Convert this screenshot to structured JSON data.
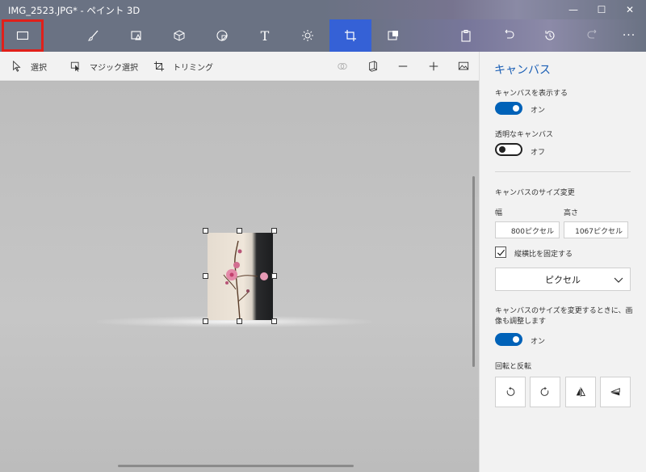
{
  "window": {
    "title": "IMG_2523.JPG* - ペイント 3D",
    "minimize": "—",
    "maximize": "☐",
    "close": "✕"
  },
  "toolbar": {
    "items": [
      {
        "id": "menu",
        "icon": "folder-icon"
      },
      {
        "id": "brushes",
        "icon": "brush-icon"
      },
      {
        "id": "2d-shapes",
        "icon": "shapes-2d-icon"
      },
      {
        "id": "3d-shapes",
        "icon": "cube-icon"
      },
      {
        "id": "stickers",
        "icon": "sticker-icon"
      },
      {
        "id": "text",
        "icon": "text-icon",
        "label": "T"
      },
      {
        "id": "effects",
        "icon": "sun-icon"
      },
      {
        "id": "canvas",
        "icon": "crop-icon",
        "active": true
      },
      {
        "id": "3d-library",
        "icon": "library-icon"
      },
      {
        "id": "paste",
        "icon": "paste-icon"
      },
      {
        "id": "undo",
        "icon": "undo-icon"
      },
      {
        "id": "history",
        "icon": "history-icon"
      },
      {
        "id": "redo",
        "icon": "redo-icon",
        "disabled": true
      },
      {
        "id": "more",
        "icon": "more-icon",
        "label": "···"
      }
    ],
    "accent_color": "#3561d6",
    "highlight_color": "#e0201a"
  },
  "subbar": {
    "select": "選択",
    "magic_select": "マジック選択",
    "crop": "トリミング"
  },
  "panel": {
    "title": "キャンバス",
    "show_canvas_label": "キャンバスを表示する",
    "show_canvas_state": "オン",
    "transparent_label": "透明なキャンバス",
    "transparent_state": "オフ",
    "resize_label": "キャンバスのサイズ変更",
    "width_label": "幅",
    "height_label": "高さ",
    "width_value": "800ピクセル",
    "height_value": "1067ピクセル",
    "lock_aspect_label": "縦横比を固定する",
    "lock_aspect_checked": true,
    "unit": "ピクセル",
    "resize_image_label": "キャンバスのサイズを変更するときに、画像も調整します",
    "resize_image_state": "オン",
    "rotate_flip_label": "回転と反転"
  }
}
